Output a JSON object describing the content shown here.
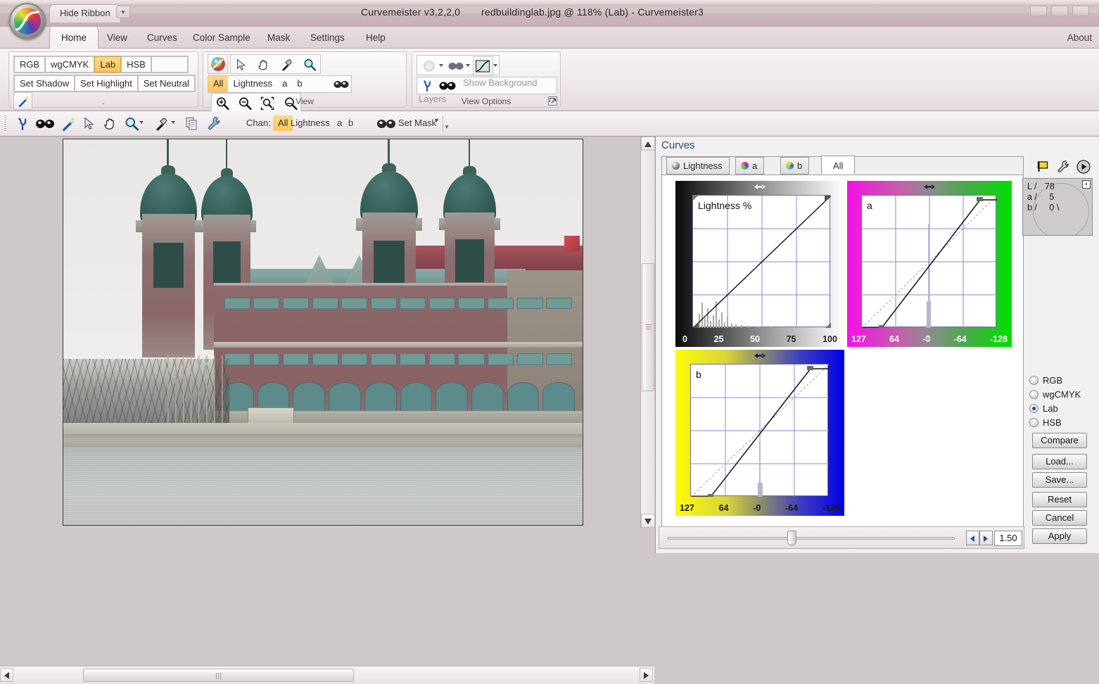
{
  "titlebar": {
    "hide_ribbon_label": "Hide Ribbon",
    "dropdown_glyph": "▾",
    "version": "Curvemeister v3,2,2,0",
    "document": "redbuildinglab.jpg @ 118% (Lab) - Curvemeister3"
  },
  "ribbon_tabs": {
    "items": [
      {
        "label": "Home",
        "active": true
      },
      {
        "label": "View",
        "active": false
      },
      {
        "label": "Curves",
        "active": false
      },
      {
        "label": "Color Sample",
        "active": false
      },
      {
        "label": "Mask",
        "active": false
      },
      {
        "label": "Settings",
        "active": false
      },
      {
        "label": "Help",
        "active": false
      }
    ],
    "about_label": "About"
  },
  "ribbon": {
    "colorspace_group": {
      "modes": [
        {
          "label": "RGB",
          "selected": false
        },
        {
          "label": "wgCMYK",
          "selected": false
        },
        {
          "label": "Lab",
          "selected": true
        },
        {
          "label": "HSB",
          "selected": false
        }
      ],
      "setters": [
        {
          "label": "Set Shadow"
        },
        {
          "label": "Set Highlight"
        },
        {
          "label": "Set Neutral"
        }
      ],
      "wand_icon": "magic-wand-icon",
      "group_label": ""
    },
    "view_group": {
      "group_label": "View",
      "tools": [
        "color-orb-icon",
        "arrow-cursor-icon",
        "hand-icon",
        "eyedropper-icon",
        "magnifier-icon"
      ],
      "channels": [
        {
          "label": "All",
          "selected": true
        },
        {
          "label": "Lightness",
          "selected": false
        },
        {
          "label": "a",
          "selected": false
        },
        {
          "label": "b",
          "selected": false
        }
      ],
      "mask_icon": "mask-glasses-icon",
      "zoom_buttons": [
        "zoom-in-icon",
        "zoom-out-icon",
        "zoom-fit-icon",
        "zoom-actual-icon"
      ]
    },
    "view_options_group": {
      "group_label": "View Options",
      "top_icons": [
        "blur-preview-icon",
        "mask-glasses-icon",
        "curve-thumbnail-icon"
      ],
      "bottom_icons": [
        "pin-icon",
        "mask-glasses-icon"
      ],
      "show_background_layers_label": "Show Background Layers",
      "dialog_launcher": "dialog-launcher-icon"
    }
  },
  "toolbar2": {
    "icons": [
      "pin-icon",
      "mask-glasses-icon",
      "magic-wand-icon",
      "arrow-cursor-icon",
      "hand-icon",
      "magnifier-icon",
      "eyedropper-icon",
      "copy-icon",
      "wrench-icon"
    ],
    "chan_label": "Chan:",
    "channels": [
      {
        "label": "All",
        "selected": true
      },
      {
        "label": "Lightness",
        "selected": false
      },
      {
        "label": "a",
        "selected": false
      },
      {
        "label": "b",
        "selected": false
      }
    ],
    "set_mask_label": "Set Mask",
    "set_mask_icon": "mask-glasses-icon"
  },
  "image": {
    "alt": "Ellis Island Immigration Museum red brick building across water, Lab mode preview",
    "zoom": "118%"
  },
  "curves": {
    "panel_title": "Curves",
    "tabs": [
      {
        "label": "Lightness",
        "dot": "#6b6b6b",
        "active": false
      },
      {
        "label": "a",
        "dot": "#cc33aa",
        "active": false
      },
      {
        "label": "b",
        "dot": "#d8d82a",
        "active": false
      },
      {
        "label": "All",
        "dot": null,
        "active": true
      }
    ],
    "header_icons": [
      "flag-icon",
      "wrench-icon",
      "play-icon"
    ],
    "readout": {
      "l_label": "L /",
      "l_value": "78",
      "a_label": "a /",
      "a_value": "5",
      "b_label": "b /",
      "b_value": "0 \\",
      "expand_glyph": "▸"
    },
    "colorspace_radios": [
      {
        "label": "RGB",
        "selected": false
      },
      {
        "label": "wgCMYK",
        "selected": false
      },
      {
        "label": "Lab",
        "selected": true
      },
      {
        "label": "HSB",
        "selected": false
      }
    ],
    "buttons": [
      "Compare",
      "Load...",
      "Save...",
      "Reset",
      "Cancel",
      "Apply"
    ],
    "slider": {
      "value": "1.50",
      "left_arrow": "◀",
      "right_arrow": "▶",
      "position_pct": 44
    }
  },
  "chart_data": [
    {
      "type": "line",
      "id": "lightness-curve",
      "title": "Lightness %",
      "xlabel": "",
      "ylabel": "",
      "xticks": [
        "0",
        "25",
        "50",
        "75",
        "100"
      ],
      "xlim": [
        0,
        100
      ],
      "ylim": [
        0,
        100
      ],
      "grid": true,
      "gridlines_x": [
        25,
        50,
        75
      ],
      "gridlines_y": [
        25,
        50,
        75
      ],
      "ramp": "black-to-white",
      "series": [
        {
          "name": "curve",
          "x": [
            0,
            100
          ],
          "values": [
            0,
            100
          ],
          "style": "solid"
        }
      ],
      "control_points": [
        {
          "x": 0,
          "y": 0
        },
        {
          "x": 100,
          "y": 100
        }
      ],
      "histogram": {
        "note": "dark-weighted, peaks between 0 and 25",
        "peaks": [
          4,
          8,
          12,
          16,
          20,
          24
        ]
      }
    },
    {
      "type": "line",
      "id": "a-curve",
      "title": "a",
      "xlabel": "",
      "ylabel": "",
      "xticks": [
        "127",
        "64",
        "-0",
        "-64",
        "-128"
      ],
      "xlim": [
        127,
        -128
      ],
      "ylim": [
        127,
        -128
      ],
      "grid": true,
      "ramp": "magenta-to-green",
      "series": [
        {
          "name": "curve",
          "x": [
            127,
            101,
            -101,
            -128
          ],
          "values": [
            127,
            127,
            -101,
            -101
          ],
          "style": "solid",
          "note": "steepened S with clipped ends"
        },
        {
          "name": "identity",
          "x": [
            127,
            -128
          ],
          "values": [
            127,
            -128
          ],
          "style": "dashed"
        }
      ],
      "control_points": [
        {
          "x": 101,
          "y": 127
        },
        {
          "x": -101,
          "y": -101
        }
      ],
      "histogram": {
        "note": "narrow spike at 0"
      }
    },
    {
      "type": "line",
      "id": "b-curve",
      "title": "b",
      "xlabel": "",
      "ylabel": "",
      "xticks": [
        "127",
        "64",
        "-0",
        "-64",
        "-128"
      ],
      "xlim": [
        127,
        -128
      ],
      "ylim": [
        127,
        -128
      ],
      "grid": true,
      "ramp": "yellow-to-blue",
      "series": [
        {
          "name": "curve",
          "x": [
            127,
            101,
            -101,
            -128
          ],
          "values": [
            127,
            127,
            -101,
            -101
          ],
          "style": "solid",
          "note": "steepened, clipped ends"
        },
        {
          "name": "identity",
          "x": [
            127,
            -128
          ],
          "values": [
            127,
            -128
          ],
          "style": "dashed"
        }
      ],
      "control_points": [
        {
          "x": 101,
          "y": 127
        },
        {
          "x": -101,
          "y": -101
        }
      ],
      "histogram": {
        "note": "narrow spike at 0"
      }
    }
  ]
}
